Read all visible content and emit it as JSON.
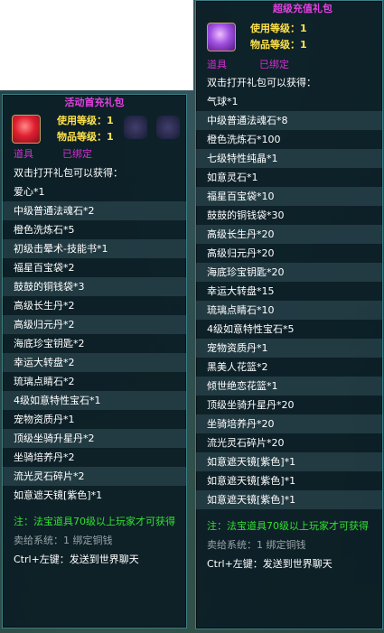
{
  "left": {
    "title": "活动首充礼包",
    "use_level_label": "使用等级：",
    "use_level": "1",
    "item_level_label": "物品等级：",
    "item_level": "1",
    "tag_type": "道具",
    "tag_bound": "已绑定",
    "intro": "双击打开礼包可以获得：",
    "items": [
      "爱心*1",
      "中级普通法魂石*2",
      "橙色洗炼石*5",
      "初级击晕术-技能书*1",
      "福星百宝袋*2",
      "鼓鼓的铜钱袋*3",
      "高级长生丹*2",
      "高级归元丹*2",
      "海底珍宝钥匙*2",
      "幸运大转盘*2",
      "琉璃点睛石*2",
      "4级如意特性宝石*1",
      "宠物资质丹*1",
      "顶级坐骑升星丹*2",
      "坐骑培养丹*2",
      "流光灵石碎片*2",
      "如意遮天镜[紫色]*1"
    ],
    "note": "注：法宝道具70级以上玩家才可获得",
    "sell": "卖给系统：1 绑定铜钱",
    "ctrl": "Ctrl+左键：发送到世界聊天"
  },
  "right": {
    "title": "超级充值礼包",
    "use_level_label": "使用等级：",
    "use_level": "1",
    "item_level_label": "物品等级：",
    "item_level": "1",
    "tag_type": "道具",
    "tag_bound": "已绑定",
    "intro": "双击打开礼包可以获得：",
    "items": [
      "气球*1",
      "中级普通法魂石*8",
      "橙色洗炼石*100",
      "七级特性纯晶*1",
      "如意灵石*1",
      "福星百宝袋*10",
      "鼓鼓的铜钱袋*30",
      "高级长生丹*20",
      "高级归元丹*20",
      "海底珍宝钥匙*20",
      "幸运大转盘*15",
      "琉璃点睛石*10",
      "4级如意特性宝石*5",
      "宠物资质丹*1",
      "黑美人花篮*2",
      "倾世绝恋花篮*1",
      "顶级坐骑升星丹*20",
      "坐骑培养丹*20",
      "流光灵石碎片*20",
      "如意遮天镜[紫色]*1",
      "如意遮天镜[紫色]*1",
      "如意遮天镜[紫色]*1"
    ],
    "note": "注：法宝道具70级以上玩家才可获得",
    "sell": "卖给系统：1 绑定铜钱",
    "ctrl": "Ctrl+左键：发送到世界聊天"
  }
}
